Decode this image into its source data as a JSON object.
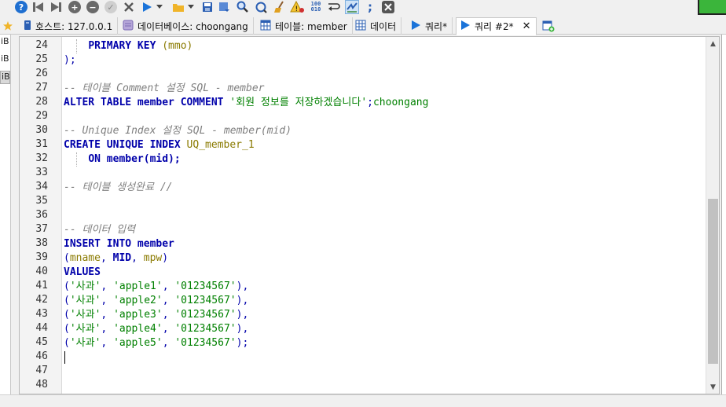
{
  "toolbar": {
    "icons": [
      "help-icon",
      "first-record-icon",
      "last-record-icon",
      "add-record-icon",
      "delete-record-icon",
      "post-record-icon",
      "cancel-record-icon",
      "run-icon",
      "run-dropdown-icon",
      "open-folder-icon",
      "open-folder-dropdown-icon",
      "save-icon",
      "load-icon",
      "find-icon",
      "find-replace-icon",
      "clean-icon",
      "warning-icon",
      "binary-icon",
      "wrap-icon",
      "format-icon",
      "semicolon-icon",
      "close-icon"
    ],
    "binary_label": "100 010",
    "semicolon_label": ";"
  },
  "tabs": [
    {
      "label": "호스트: 127.0.0.1",
      "icon": "host-icon"
    },
    {
      "label": "데이터베이스: choongang",
      "icon": "database-icon"
    },
    {
      "label": "테이블: member",
      "icon": "table-icon"
    },
    {
      "label": "데이터",
      "icon": "data-grid-icon"
    },
    {
      "label": "쿼리*",
      "icon": "query-play-icon"
    },
    {
      "label": "쿼리 #2*",
      "icon": "query-play-icon",
      "active": true
    },
    {
      "label": "",
      "icon": "new-query-tab-icon"
    }
  ],
  "tab_close": "✕",
  "left_strip": [
    "iB",
    "iB",
    "iB"
  ],
  "editor": {
    "lines": [
      {
        "n": "24",
        "html": "    <span class=\"kw\">PRIMARY KEY</span> <span class=\"ylw\">(mmo)</span>",
        "guide": true
      },
      {
        "n": "25",
        "html": "<span class=\"op\">);</span>"
      },
      {
        "n": "26",
        "html": ""
      },
      {
        "n": "27",
        "html": "<span class=\"cmt\">-- 테이블 Comment 설정 SQL - member</span>"
      },
      {
        "n": "28",
        "html": "<span class=\"kw\">ALTER TABLE member COMMENT</span> <span class=\"str\">'회원 정보를 저장하겠습니다'</span><span class=\"op\">;</span><span class=\"str\">choongang</span>"
      },
      {
        "n": "29",
        "html": ""
      },
      {
        "n": "30",
        "html": "<span class=\"cmt\">-- Unique Index 설정 SQL - member(mid)</span>"
      },
      {
        "n": "31",
        "html": "<span class=\"kw\">CREATE UNIQUE INDEX</span> <span class=\"ylw\">UQ_member_1</span>"
      },
      {
        "n": "32",
        "html": "    <span class=\"kw\">ON member(mid);</span>",
        "guide": true
      },
      {
        "n": "33",
        "html": ""
      },
      {
        "n": "34",
        "html": "<span class=\"cmt\">-- 테이블 생성완료 //</span>"
      },
      {
        "n": "35",
        "html": ""
      },
      {
        "n": "36",
        "html": ""
      },
      {
        "n": "37",
        "html": "<span class=\"cmt\">-- 데이터 입력</span>"
      },
      {
        "n": "38",
        "html": "<span class=\"kw\">INSERT INTO member</span>"
      },
      {
        "n": "39",
        "html": "<span class=\"op\">(</span><span class=\"ylw\">mname</span><span class=\"op\">, </span><span class=\"kw\">MID</span><span class=\"op\">, </span><span class=\"ylw\">mpw</span><span class=\"op\">)</span>"
      },
      {
        "n": "40",
        "html": "<span class=\"kw\">VALUES</span>"
      },
      {
        "n": "41",
        "html": "<span class=\"op\">(</span><span class=\"str\">'사과'</span><span class=\"op\">, </span><span class=\"str\">'apple1'</span><span class=\"op\">, </span><span class=\"str\">'01234567'</span><span class=\"op\">),</span>"
      },
      {
        "n": "42",
        "html": "<span class=\"op\">(</span><span class=\"str\">'사과'</span><span class=\"op\">, </span><span class=\"str\">'apple2'</span><span class=\"op\">, </span><span class=\"str\">'01234567'</span><span class=\"op\">),</span>"
      },
      {
        "n": "43",
        "html": "<span class=\"op\">(</span><span class=\"str\">'사과'</span><span class=\"op\">, </span><span class=\"str\">'apple3'</span><span class=\"op\">, </span><span class=\"str\">'01234567'</span><span class=\"op\">),</span>"
      },
      {
        "n": "44",
        "html": "<span class=\"op\">(</span><span class=\"str\">'사과'</span><span class=\"op\">, </span><span class=\"str\">'apple4'</span><span class=\"op\">, </span><span class=\"str\">'01234567'</span><span class=\"op\">),</span>"
      },
      {
        "n": "45",
        "html": "<span class=\"op\">(</span><span class=\"str\">'사과'</span><span class=\"op\">, </span><span class=\"str\">'apple5'</span><span class=\"op\">, </span><span class=\"str\">'01234567'</span><span class=\"op\">);</span>"
      },
      {
        "n": "46",
        "html": ""
      },
      {
        "n": "47",
        "html": ""
      },
      {
        "n": "48",
        "html": ""
      }
    ],
    "caret_line": "46",
    "scroll_position": 0.45
  },
  "colors": {
    "keyword": "#0000aa",
    "string": "#008000",
    "comment": "#7f7f7f",
    "identifier_yellow": "#8a7a00",
    "active_tab": "#ffffff"
  }
}
